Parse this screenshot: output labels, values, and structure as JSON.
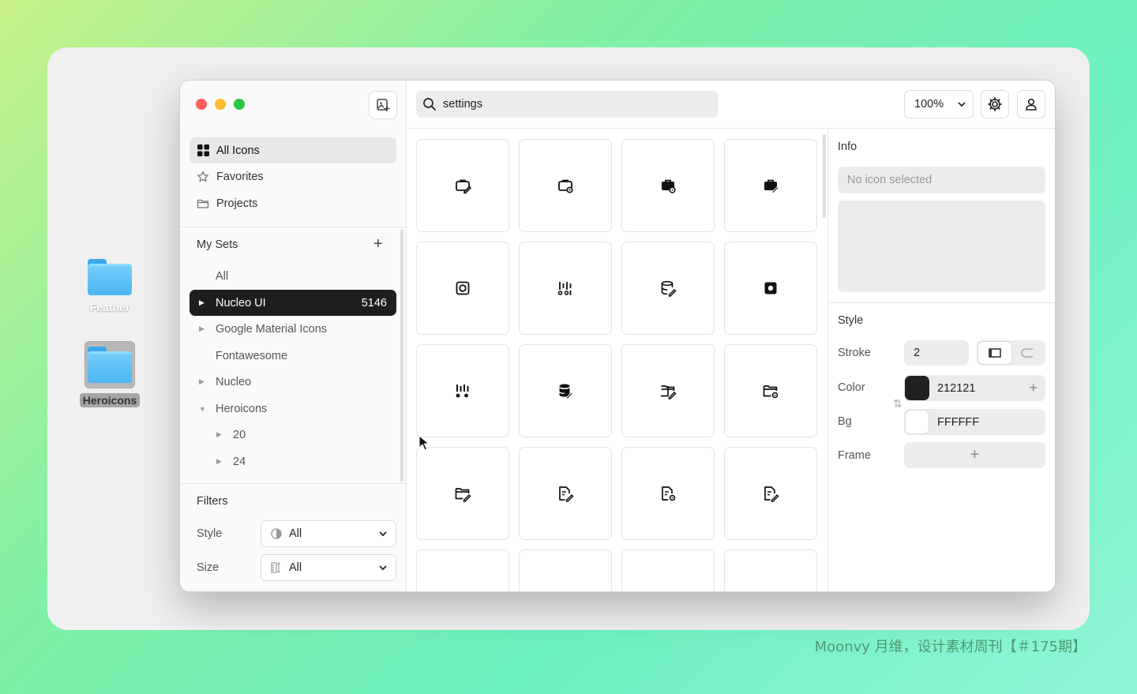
{
  "desktop": {
    "folders": [
      {
        "name": "Feather"
      },
      {
        "name": "Heroicons"
      }
    ]
  },
  "sidebar": {
    "nav": [
      {
        "label": "All Icons",
        "icon": "grid-icon"
      },
      {
        "label": "Favorites",
        "icon": "star-icon"
      },
      {
        "label": "Projects",
        "icon": "folder-icon"
      }
    ],
    "my_sets_title": "My Sets",
    "sets": [
      {
        "label": "All",
        "count": ""
      },
      {
        "label": "Nucleo UI",
        "count": "5146"
      },
      {
        "label": "Google Material Icons",
        "count": ""
      },
      {
        "label": "Fontawesome",
        "count": ""
      },
      {
        "label": "Nucleo",
        "count": ""
      },
      {
        "label": "Heroicons",
        "count": ""
      },
      {
        "label": "20",
        "count": ""
      },
      {
        "label": "24",
        "count": ""
      }
    ],
    "filters_title": "Filters",
    "filters": [
      {
        "label": "Style",
        "value": "All"
      },
      {
        "label": "Size",
        "value": "All"
      }
    ]
  },
  "topbar": {
    "search_value": "settings",
    "zoom": "100%"
  },
  "inspector": {
    "info_title": "Info",
    "no_selection": "No icon selected",
    "style_title": "Style",
    "stroke_label": "Stroke",
    "stroke_value": "2",
    "color_label": "Color",
    "color_value": "212121",
    "bg_label": "Bg",
    "bg_value": "FFFFFF",
    "frame_label": "Frame"
  },
  "colors": {
    "accent_dark": "#1e1e1e",
    "color_swatch": "#212121",
    "bg_swatch": "#FFFFFF",
    "traffic_red": "#ff5f57",
    "traffic_yellow": "#febc2e",
    "traffic_green": "#28c840"
  },
  "grid_icons": [
    "briefcase-pen-icon",
    "briefcase-gear-icon",
    "briefcase-gear-filled-icon",
    "briefcase-pen-filled-icon",
    "square-target-icon",
    "sliders-vertical-icon",
    "database-pen-icon",
    "square-dot-filled-icon",
    "sliders-vertical-filled-icon",
    "database-pen-filled-icon",
    "folder-pen-icon",
    "folder-gear-icon",
    "folder-pen-alt-icon",
    "file-pen-icon",
    "file-gear-icon",
    "file-pen-alt-icon"
  ],
  "watermark": "Moonvy 月维，设计素材周刊【＃175期】"
}
